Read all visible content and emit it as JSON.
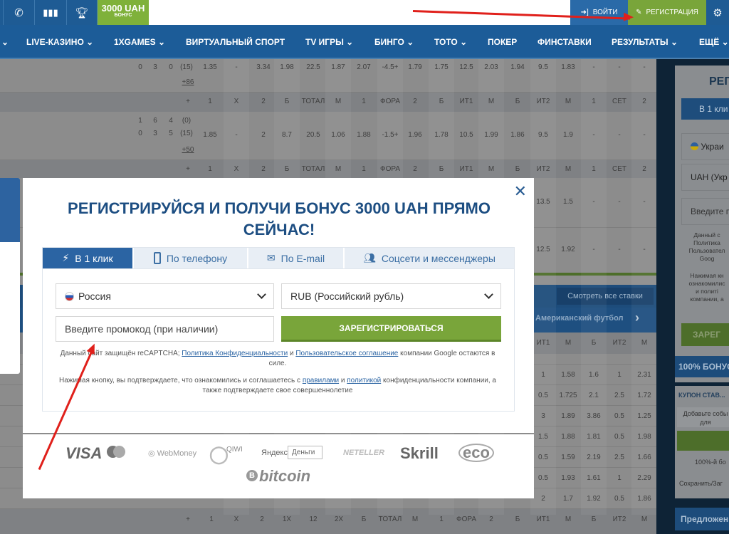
{
  "topbar": {
    "icons": [
      "phone-icon",
      "stats-icon",
      "trophy-icon"
    ],
    "bonus_amount": "3000 UAH",
    "bonus_label": "БОНУС",
    "login": "ВОЙТИ",
    "register": "РЕГИСТРАЦИЯ"
  },
  "nav": [
    "LIVE-КАЗИНО",
    "1XGAMES",
    "ВИРТУАЛЬНЫЙ СПОРТ",
    "TV ИГРЫ",
    "БИНГО",
    "ТОТО",
    "ПОКЕР",
    "ФИНСТАВКИ",
    "РЕЗУЛЬТАТЫ",
    "ЕЩЁ"
  ],
  "table": {
    "row1": {
      "score": [
        "0",
        "3",
        "0",
        "(15)"
      ],
      "more": "+86",
      "odds": [
        "1.35",
        "-",
        "3.34",
        "1.98",
        "22.5",
        "1.87",
        "2.07",
        "-4.5+",
        "1.79",
        "1.75",
        "12.5",
        "2.03",
        "1.94",
        "9.5",
        "1.83",
        "-",
        "-",
        "-"
      ]
    },
    "header": [
      "+",
      "1",
      "X",
      "2",
      "Б",
      "ТОТАЛ",
      "М",
      "1",
      "ФОРА",
      "2",
      "Б",
      "ИТ1",
      "М",
      "Б",
      "ИТ2",
      "М",
      "1",
      "СЕТ",
      "2"
    ],
    "row2": {
      "score_top": [
        "1",
        "6",
        "4",
        "(0)"
      ],
      "score_bottom": [
        "0",
        "3",
        "5",
        "(15)"
      ],
      "more": "+50",
      "odds": [
        "1.85",
        "-",
        "2",
        "8.7",
        "20.5",
        "1.06",
        "1.88",
        "-1.5+",
        "1.96",
        "1.78",
        "10.5",
        "1.99",
        "1.86",
        "9.5",
        "1.9",
        "-",
        "-",
        "-"
      ]
    },
    "row3_visible": [
      "13.5",
      "1.5",
      "-",
      "-",
      "-"
    ],
    "row4_visible": [
      "12.5",
      "1.92",
      "-",
      "-",
      "-"
    ],
    "see_all": "Смотреть все ставки",
    "sport_header": "Американский футбол",
    "sub_header": [
      "ИТ1",
      "М",
      "Б",
      "ИТ2",
      "М"
    ],
    "sub_rows": [
      [
        "1",
        "1.58",
        "1.6",
        "1",
        "2.31"
      ],
      [
        "0.5",
        "1.725",
        "2.1",
        "2.5",
        "1.72"
      ],
      [
        "3",
        "1.89",
        "3.86",
        "0.5",
        "1.25"
      ],
      [
        "1.5",
        "1.88",
        "1.81",
        "0.5",
        "1.98"
      ],
      [
        "0.5",
        "1.59",
        "2.19",
        "2.5",
        "1.66"
      ],
      [
        "0.5",
        "1.93",
        "1.61",
        "1",
        "2.29"
      ],
      [
        "2",
        "1.7",
        "1.92",
        "0.5",
        "1.86"
      ]
    ],
    "bottom_header": [
      "+",
      "1",
      "X",
      "2",
      "1X",
      "12",
      "2X",
      "Б",
      "ТОТАЛ",
      "М",
      "1",
      "ФОРА",
      "2",
      "Б",
      "ИТ1",
      "М",
      "Б",
      "ИТ2",
      "М"
    ]
  },
  "sidebar": {
    "title": "РЕГ",
    "one_click": "В 1 кли",
    "country": "Украи",
    "currency": "UAH (Укр",
    "promo": "Введите п",
    "captcha": [
      "Данный с",
      "Политика",
      "Пользовател",
      "Goog"
    ],
    "agree": [
      "Нажимая кн",
      "ознакомилис",
      "и политі",
      "компании, а"
    ],
    "register": "ЗАРЕГ",
    "bonus": "100% БОНУС",
    "coupon": "КУПОН СТАВ...",
    "coupon_text": [
      "Добавьте собы",
      "для"
    ],
    "coupon_bonus": "100%-й бо",
    "save": "Сохранить/Заг",
    "offers": "Предложен"
  },
  "modal": {
    "title": "РЕГИСТРИРУЙСЯ И ПОЛУЧИ БОНУС 3000 UAH ПРЯМО СЕЙЧАС!",
    "tabs": [
      {
        "label": "В 1 клик",
        "icon": "lightning-icon",
        "active": true
      },
      {
        "label": "По телефону",
        "icon": "phone-icon",
        "active": false
      },
      {
        "label": "По E-mail",
        "icon": "envelope-icon",
        "active": false
      },
      {
        "label": "Соцсети и мессенджеры",
        "icon": "users-icon",
        "active": false
      }
    ],
    "country": "Россия",
    "currency": "RUB (Российский рубль)",
    "promo_placeholder": "Введите промокод (при наличии)",
    "submit": "ЗАРЕГИСТРИРОВАТЬСЯ",
    "captcha_pre": "Данный сайт защищён reCAPTCHA; ",
    "captcha_privacy": "Политика Конфиденциальности",
    "captcha_and": " и ",
    "captcha_terms": "Пользовательское соглашение",
    "captcha_post": " компании Google остаются в силе.",
    "agree_pre": "Нажимая кнопку, вы подтверждаете, что ознакомились и соглашаетесь с ",
    "agree_rules": "правилами",
    "agree_and": " и ",
    "agree_policy": "политикой",
    "agree_post": " конфиденциальности компании, а также подтверждаете свое совершеннолетие"
  },
  "payments": [
    "VISA",
    "WebMoney",
    "QIWI",
    "Яндекс",
    "Деньги",
    "NETELLER",
    "Skrill",
    "eco",
    "bitcoin"
  ],
  "colors": {
    "brand_blue": "#1c5c98",
    "accent_green": "#79a53a",
    "annotation_red": "#e0201b"
  }
}
